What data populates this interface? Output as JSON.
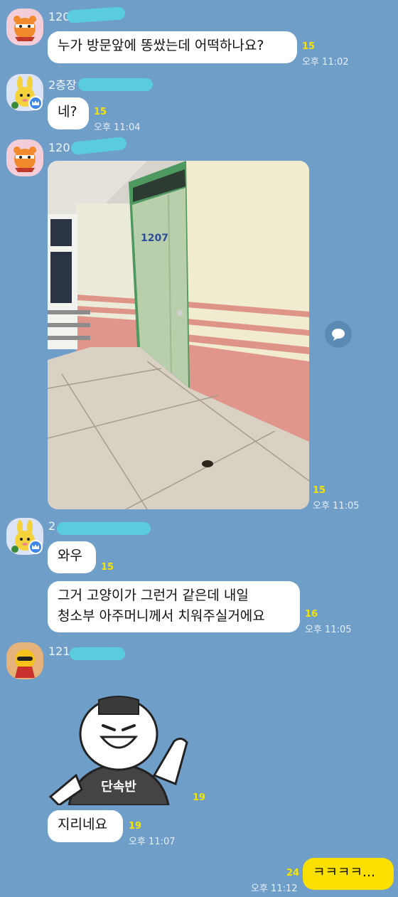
{
  "chat": {
    "msg1": {
      "sender": "120",
      "text": "누가 방문앞에 똥쌌는데 어떡하나요?",
      "unread": "15",
      "time": "오후 11:02"
    },
    "msg2": {
      "sender": "2층장",
      "text": "네?",
      "unread": "15",
      "time": "오후 11:04"
    },
    "msg3": {
      "sender": "120",
      "door_number": "1207",
      "unread": "15",
      "time": "오후 11:05"
    },
    "msg4": {
      "sender": "2",
      "text1": "와우",
      "unread1": "15",
      "text2_line1": "그거 고양이가 그런거 같은데 내일",
      "text2_line2": "청소부 아주머니께서 치워주실거에요",
      "unread2": "16",
      "time": "오후 11:05"
    },
    "msg5": {
      "sender": "121",
      "sticker_text": "단속반",
      "sticker_unread": "19",
      "text": "지리네요",
      "unread": "19",
      "time": "오후 11:07"
    },
    "msg6": {
      "text": "ㅋㅋㅋㅋ...",
      "unread": "24",
      "time": "오후 11:12"
    }
  },
  "colors": {
    "background": "#6f9ec9",
    "my_bubble": "#f9e000",
    "unread": "#f6e300"
  },
  "icons": {
    "share": "share-bubble-icon"
  }
}
